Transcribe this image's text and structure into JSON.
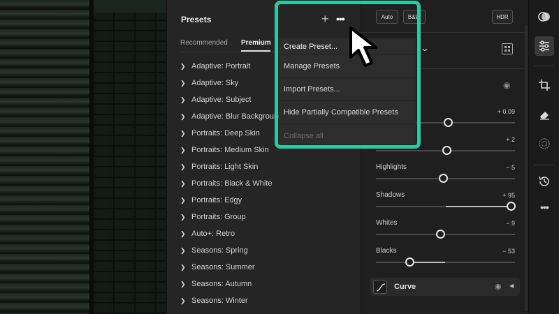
{
  "presets_panel": {
    "title": "Presets",
    "add_icon": "plus-icon",
    "more_icon": "more-horizontal-icon",
    "tabs": [
      {
        "label": "Recommended",
        "active": false
      },
      {
        "label": "Premium",
        "active": true
      }
    ],
    "items": [
      "Adaptive: Portrait",
      "Adaptive: Sky",
      "Adaptive: Subject",
      "Adaptive: Blur Background",
      "Portraits: Deep Skin",
      "Portraits: Medium Skin",
      "Portraits: Light Skin",
      "Portraits: Black & White",
      "Portraits: Edgy",
      "Portraits: Group",
      "Auto+: Retro",
      "Seasons: Spring",
      "Seasons: Summer",
      "Seasons: Autumn",
      "Seasons: Winter"
    ]
  },
  "menu": {
    "items": [
      {
        "label": "Create Preset...",
        "enabled": true
      },
      {
        "label": "Manage Presets",
        "enabled": true
      },
      {
        "label": "Import Presets...",
        "enabled": true
      },
      {
        "label": "Hide Partially Compatible Presets",
        "enabled": true
      },
      {
        "label": "Collapse all",
        "enabled": false
      }
    ],
    "highlight_color": "#2bc9a3"
  },
  "edit_panel": {
    "auto_label": "Auto",
    "bw_label": "B&W",
    "hdr_label": "HDR",
    "sliders": [
      {
        "label": "",
        "value": "+ 0.09",
        "level": 0.52
      },
      {
        "label": "",
        "value": "+ 2",
        "level": 0.51
      },
      {
        "label": "Highlights",
        "value": "− 5",
        "level": 0.48
      },
      {
        "label": "Shadows",
        "value": "+ 95",
        "level": 0.97
      },
      {
        "label": "Whites",
        "value": "− 9",
        "level": 0.46
      },
      {
        "label": "Blacks",
        "value": "− 53",
        "level": 0.24
      }
    ],
    "curve_label": "Curve"
  },
  "toolbar": {
    "tools": [
      "presets-icon",
      "edit-sliders-icon",
      "crop-icon",
      "eraser-icon",
      "masking-icon",
      "history-icon",
      "more-icon"
    ]
  }
}
